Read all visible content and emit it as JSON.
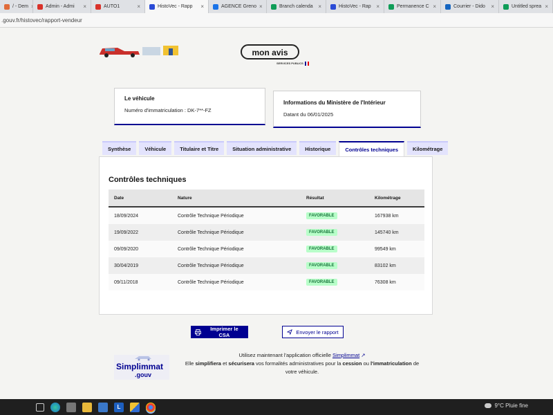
{
  "browser": {
    "tabs": [
      {
        "label": "/ - Dem",
        "color": "#e06b3a"
      },
      {
        "label": "Admin - Admi",
        "color": "#d9322a"
      },
      {
        "label": "AUTO1",
        "color": "#d9322a"
      },
      {
        "label": "HistoVec - Rapp",
        "color": "#2b4bd6",
        "active": true
      },
      {
        "label": "AGENCE Greno",
        "color": "#1a73e8"
      },
      {
        "label": "Branch calenda",
        "color": "#0f9d58"
      },
      {
        "label": "HistoVec - Rap",
        "color": "#2b4bd6"
      },
      {
        "label": "Permanence C",
        "color": "#0f9d58"
      },
      {
        "label": "Courrier - Dido",
        "color": "#1565c0"
      },
      {
        "label": "Untitled sprea",
        "color": "#0f9d58"
      }
    ],
    "url": ".gouv.fr/histovec/rapport-vendeur"
  },
  "header": {
    "avis_label": "mon avis",
    "sp_logo": "SERVICES PUBLICS"
  },
  "vehicle_card": {
    "title": "Le véhicule",
    "value": "Numéro d'immatriculation : DK-7**-FZ"
  },
  "ministry_card": {
    "title": "Informations du Ministère de l'Intérieur",
    "value": "Datant du 06/01/2025"
  },
  "tabs": [
    {
      "label": "Synthèse"
    },
    {
      "label": "Véhicule"
    },
    {
      "label": "Titulaire et Titre"
    },
    {
      "label": "Situation administrative"
    },
    {
      "label": "Historique"
    },
    {
      "label": "Contrôles techniques",
      "active": true
    },
    {
      "label": "Kilométrage"
    }
  ],
  "section": {
    "title": "Contrôles techniques",
    "columns": [
      "Date",
      "Nature",
      "Résultat",
      "Kilométrage"
    ],
    "rows": [
      {
        "date": "18/09/2024",
        "nature": "Contrôle Technique Périodique",
        "result": "FAVORABLE",
        "km": "167938 km"
      },
      {
        "date": "19/09/2022",
        "nature": "Contrôle Technique Périodique",
        "result": "FAVORABLE",
        "km": "145740 km"
      },
      {
        "date": "09/09/2020",
        "nature": "Contrôle Technique Périodique",
        "result": "FAVORABLE",
        "km": "99549 km"
      },
      {
        "date": "30/04/2019",
        "nature": "Contrôle Technique Périodique",
        "result": "FAVORABLE",
        "km": "83102 km"
      },
      {
        "date": "09/11/2018",
        "nature": "Contrôle Technique Périodique",
        "result": "FAVORABLE",
        "km": "76308 km"
      }
    ]
  },
  "actions": {
    "print": "Imprimer le CSA",
    "send": "Envoyer le rapport"
  },
  "simplimmat": {
    "logo_line1": "Simplimmat",
    "logo_line2": ".gouv",
    "text_prefix": "Utilisez maintenant l'application officielle",
    "link": "Simplimmat",
    "text_line2_a": "Elle",
    "bold1": "simplifiera",
    "text_line2_b": "et",
    "bold2": "sécurisera",
    "text_line2_c": "vos formalités administratives pour la",
    "bold3": "cession",
    "text_line2_d": "ou",
    "bold4": "l'immatriculation",
    "text_line2_e": "de",
    "text_line3": "votre véhicule."
  },
  "taskbar": {
    "weather": "9°C  Pluie fine"
  },
  "colors": {
    "primary": "#000091",
    "success_bg": "#b8fec9",
    "success_text": "#18753c"
  }
}
